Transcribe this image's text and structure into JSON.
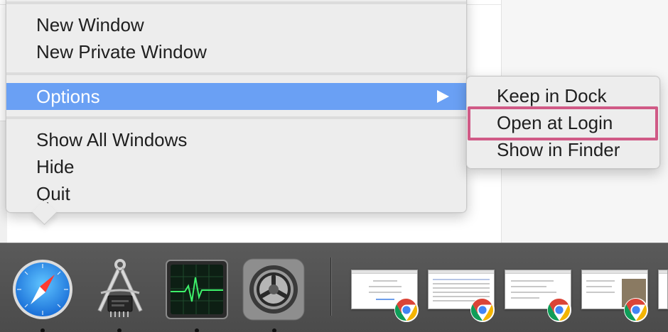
{
  "menu": {
    "items": {
      "new_window": "New Window",
      "new_private_window": "New Private Window",
      "options": "Options",
      "show_all_windows": "Show All Windows",
      "hide": "Hide",
      "quit": "Quit"
    },
    "highlight_color": "#6aa0f4"
  },
  "submenu": {
    "items": {
      "keep_in_dock": "Keep in Dock",
      "open_at_login": "Open at Login",
      "show_in_finder": "Show in Finder"
    },
    "focus_outline_color": "#d05a86"
  },
  "dock": {
    "apps": [
      {
        "icon": "safari-icon",
        "running": true
      },
      {
        "icon": "system-information-icon",
        "running": true
      },
      {
        "icon": "activity-monitor-icon",
        "running": true
      },
      {
        "icon": "system-preferences-icon",
        "running": true
      }
    ],
    "minimized_windows": [
      {
        "icon": "chrome-icon"
      },
      {
        "icon": "chrome-icon"
      },
      {
        "icon": "chrome-icon"
      },
      {
        "icon": "chrome-icon"
      }
    ]
  }
}
